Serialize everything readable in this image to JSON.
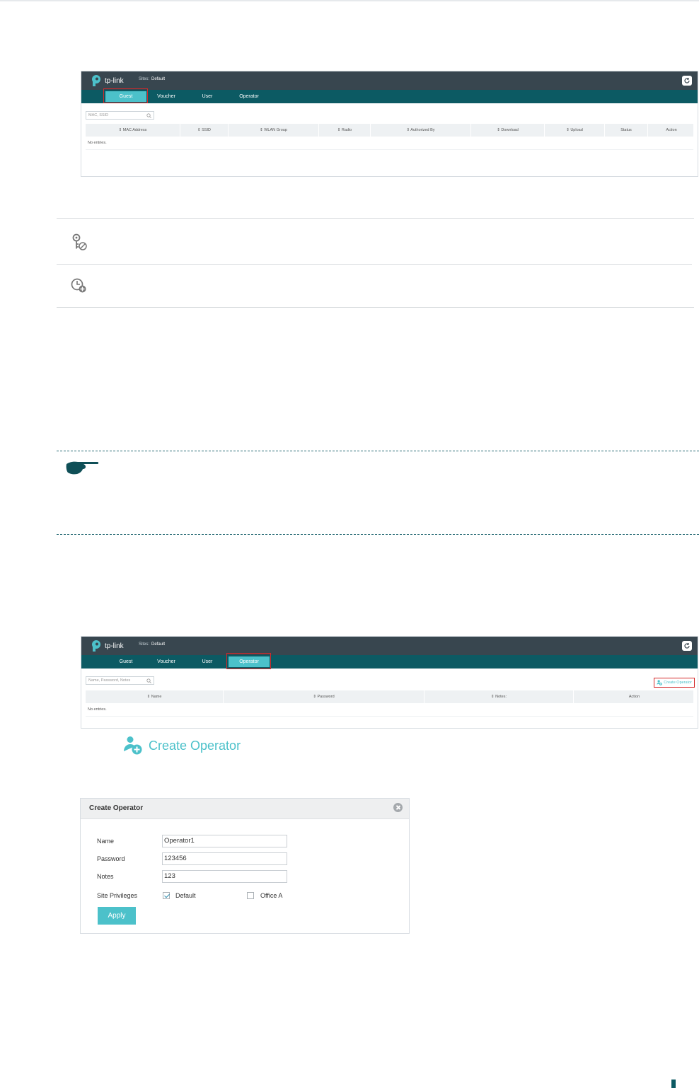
{
  "app": {
    "logo_text": "tp-link",
    "sites_label": "Sites:",
    "sites_value": "Default"
  },
  "shot1": {
    "tabs": [
      "Guest",
      "Voucher",
      "User",
      "Operator"
    ],
    "search_placeholder": "MAC, SSID",
    "columns": [
      "⇕ MAC Address",
      "⇕ SSID",
      "⇕ WLAN Group",
      "⇕ Radio",
      "⇕ Authorized By",
      "⇕ Download",
      "⇕ Upload",
      "Status",
      "Action"
    ],
    "empty_text": "No entries."
  },
  "icons": [
    "unauthorize-key-icon",
    "extend-time-icon"
  ],
  "shot2": {
    "tabs": [
      "Guest",
      "Voucher",
      "User",
      "Operator"
    ],
    "search_placeholder": "Name, Password, Notes",
    "create_link": "Create Operator",
    "columns": [
      "⇕ Name",
      "⇕ Password",
      "⇕ Notes:",
      "Action"
    ],
    "empty_text": "No entries."
  },
  "big_create_label": "Create Operator",
  "dialog": {
    "title": "Create Operator",
    "name_label": "Name",
    "name_value": "Operator1",
    "password_label": "Password",
    "password_value": "123456",
    "notes_label": "Notes",
    "notes_value": "123",
    "privileges_label": "Site Privileges",
    "site_default": "Default",
    "site_office": "Office A",
    "apply_label": "Apply"
  },
  "colors": {
    "header": "#38464f",
    "tabbar": "#0c5a63",
    "accent": "#4cc1ca",
    "highlight": "#d42a2a"
  }
}
